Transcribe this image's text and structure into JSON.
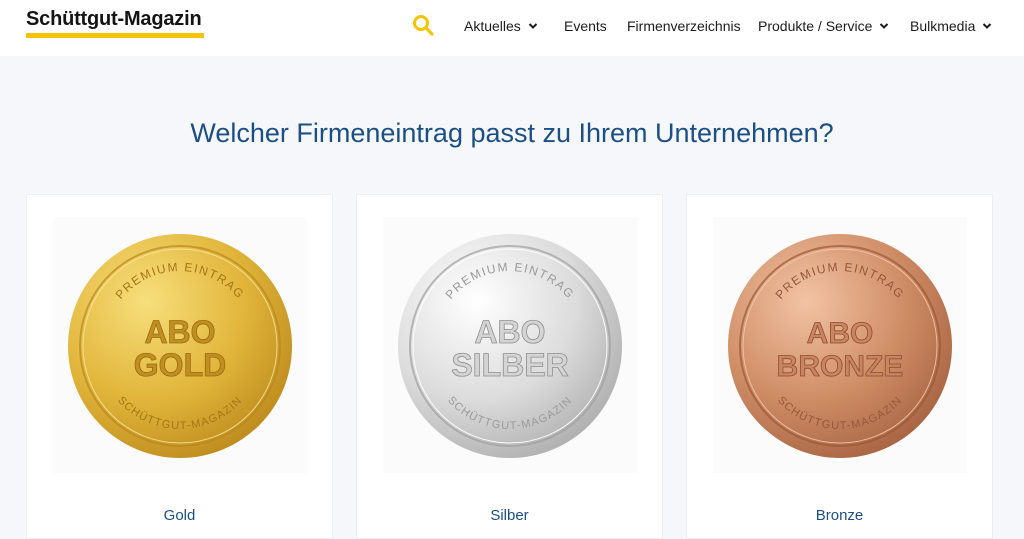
{
  "header": {
    "logo_text": "Schüttgut-Magazin",
    "brand_color": "#f5c400",
    "search_icon": "search-icon",
    "nav": [
      {
        "label": "Aktuelles",
        "has_dropdown": true
      },
      {
        "label": "Events",
        "has_dropdown": false
      },
      {
        "label": "Firmenverzeichnis",
        "has_dropdown": false
      },
      {
        "label": "Produkte / Service",
        "has_dropdown": true
      },
      {
        "label": "Bulkmedia",
        "has_dropdown": true
      }
    ]
  },
  "main": {
    "headline": "Welcher Firmeneintrag passt zu Ihrem Unternehmen?",
    "accent_color": "#1b4f86",
    "cards": [
      {
        "label": "Gold",
        "coin": {
          "top": "PREMIUM EINTRAG",
          "line1": "ABO",
          "line2": "GOLD",
          "bottom": "SCHÜTTGUT-MAGAZIN",
          "color": "#d9a82a"
        }
      },
      {
        "label": "Silber",
        "coin": {
          "top": "PREMIUM EINTRAG",
          "line1": "ABO",
          "line2": "SILBER",
          "bottom": "SCHÜTTGUT-MAGAZIN",
          "color": "#c8c8c8"
        }
      },
      {
        "label": "Bronze",
        "coin": {
          "top": "PREMIUM EINTRAG",
          "line1": "ABO",
          "line2": "BRONZE",
          "bottom": "SCHÜTTGUT-MAGAZIN",
          "color": "#c78460"
        }
      }
    ]
  }
}
